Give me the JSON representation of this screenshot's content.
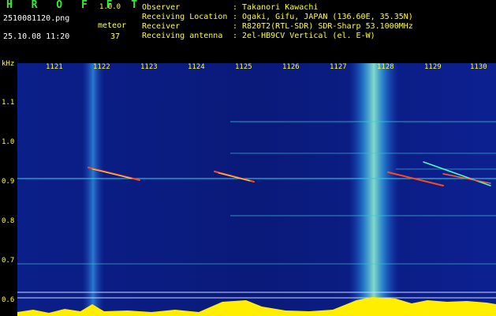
{
  "header": {
    "app_name": "H R O F F T",
    "version": "1.0.0",
    "filename": "2510081120.png",
    "meteor_label": "meteor",
    "meteor_count": "37",
    "datetime": "25.10.08 11:20",
    "observer_label": "Observer",
    "observer_value": ": Takanori Kawachi",
    "location_label": "Receiving Location",
    "location_value": ": Ogaki, Gifu, JAPAN (136.60E, 35.35N)",
    "receiver_label": "Receiver",
    "receiver_value": ": R820T2(RTL-SDR) SDR-Sharp 53.1000MHz",
    "antenna_label": "Receiving antenna",
    "antenna_value": ": 2el-HB9CV Vertical (el. E-W)"
  },
  "axes": {
    "y_unit": "kHz",
    "y_ticks": [
      "1.1",
      "1.0",
      "0.9",
      "0.8",
      "0.7",
      "0.6"
    ],
    "x_ticks": [
      "1121",
      "1122",
      "1123",
      "1124",
      "1125",
      "1126",
      "1127",
      "1128",
      "1129",
      "1130"
    ]
  },
  "colors": {
    "background": "#000000",
    "waterfall_bg": "#0a1a7a",
    "label_yellow": "#ffff33",
    "title_green": "#33ee33",
    "signal_cyan": "#33ccff",
    "signal_red": "#ff3300"
  }
}
